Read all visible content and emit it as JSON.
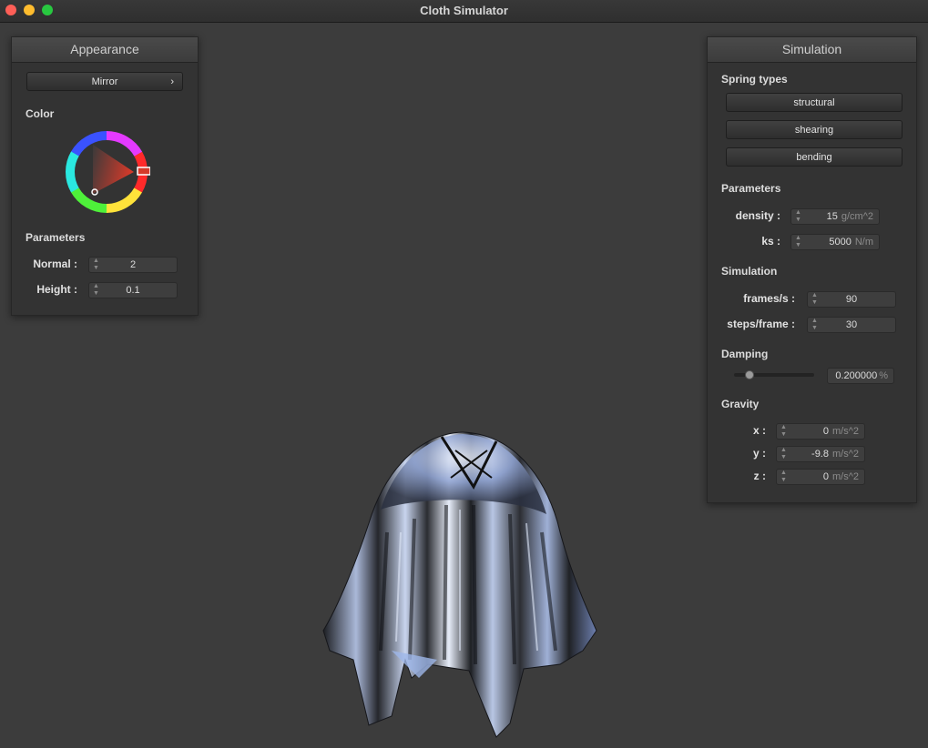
{
  "window": {
    "title": "Cloth Simulator"
  },
  "appearance": {
    "title": "Appearance",
    "shader_label": "Mirror",
    "chevron": "›",
    "color_label": "Color",
    "params_label": "Parameters",
    "normal_label": "Normal :",
    "normal_value": "2",
    "height_label": "Height :",
    "height_value": "0.1"
  },
  "simulation": {
    "title": "Simulation",
    "spring_types_label": "Spring types",
    "spring_buttons": [
      "structural",
      "shearing",
      "bending"
    ],
    "params_label": "Parameters",
    "density_label": "density :",
    "density_value": "15",
    "density_unit": "g/cm^2",
    "ks_label": "ks :",
    "ks_value": "5000",
    "ks_unit": "N/m",
    "sim_label": "Simulation",
    "fps_label": "frames/s :",
    "fps_value": "90",
    "steps_label": "steps/frame :",
    "steps_value": "30",
    "damping_label": "Damping",
    "damping_value": "0.200000",
    "damping_unit": "%",
    "gravity_label": "Gravity",
    "gx_label": "x :",
    "gx_value": "0",
    "gy_label": "y :",
    "gy_value": "-9.8",
    "gz_label": "z :",
    "gz_value": "0",
    "gravity_unit": "m/s^2"
  },
  "colors": {
    "background": "#3c3c3c",
    "panel": "#333333",
    "selected_hue": "#d43a2a"
  }
}
